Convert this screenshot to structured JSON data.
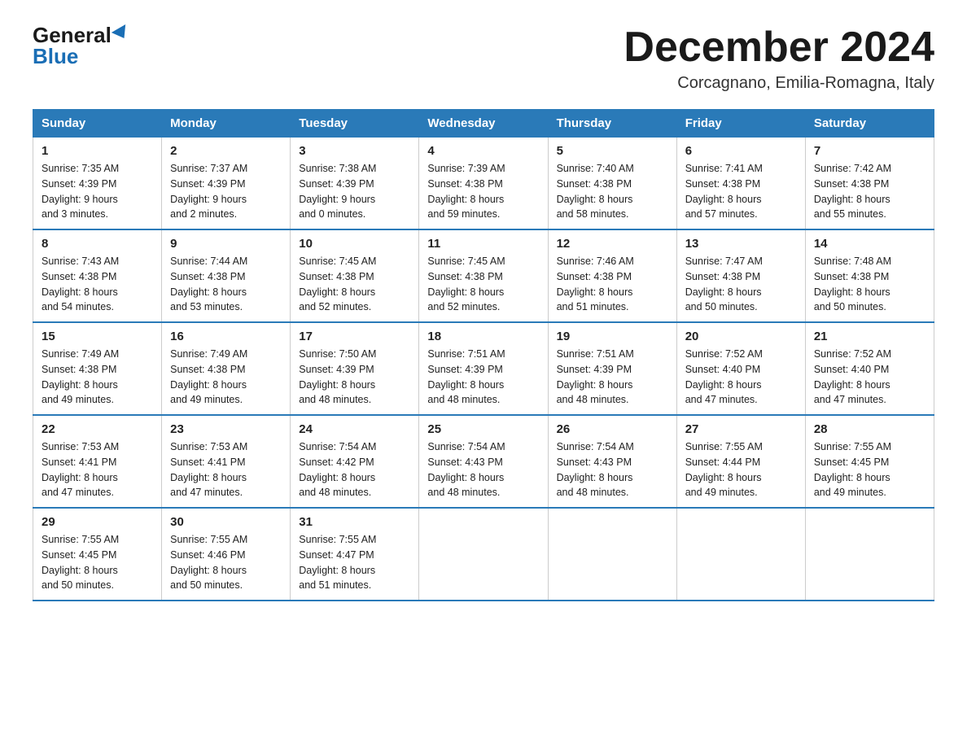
{
  "header": {
    "logo_general": "General",
    "logo_blue": "Blue",
    "month_title": "December 2024",
    "location": "Corcagnano, Emilia-Romagna, Italy"
  },
  "days_of_week": [
    "Sunday",
    "Monday",
    "Tuesday",
    "Wednesday",
    "Thursday",
    "Friday",
    "Saturday"
  ],
  "weeks": [
    [
      {
        "day": "1",
        "sunrise": "7:35 AM",
        "sunset": "4:39 PM",
        "daylight": "9 hours and 3 minutes."
      },
      {
        "day": "2",
        "sunrise": "7:37 AM",
        "sunset": "4:39 PM",
        "daylight": "9 hours and 2 minutes."
      },
      {
        "day": "3",
        "sunrise": "7:38 AM",
        "sunset": "4:39 PM",
        "daylight": "9 hours and 0 minutes."
      },
      {
        "day": "4",
        "sunrise": "7:39 AM",
        "sunset": "4:38 PM",
        "daylight": "8 hours and 59 minutes."
      },
      {
        "day": "5",
        "sunrise": "7:40 AM",
        "sunset": "4:38 PM",
        "daylight": "8 hours and 58 minutes."
      },
      {
        "day": "6",
        "sunrise": "7:41 AM",
        "sunset": "4:38 PM",
        "daylight": "8 hours and 57 minutes."
      },
      {
        "day": "7",
        "sunrise": "7:42 AM",
        "sunset": "4:38 PM",
        "daylight": "8 hours and 55 minutes."
      }
    ],
    [
      {
        "day": "8",
        "sunrise": "7:43 AM",
        "sunset": "4:38 PM",
        "daylight": "8 hours and 54 minutes."
      },
      {
        "day": "9",
        "sunrise": "7:44 AM",
        "sunset": "4:38 PM",
        "daylight": "8 hours and 53 minutes."
      },
      {
        "day": "10",
        "sunrise": "7:45 AM",
        "sunset": "4:38 PM",
        "daylight": "8 hours and 52 minutes."
      },
      {
        "day": "11",
        "sunrise": "7:45 AM",
        "sunset": "4:38 PM",
        "daylight": "8 hours and 52 minutes."
      },
      {
        "day": "12",
        "sunrise": "7:46 AM",
        "sunset": "4:38 PM",
        "daylight": "8 hours and 51 minutes."
      },
      {
        "day": "13",
        "sunrise": "7:47 AM",
        "sunset": "4:38 PM",
        "daylight": "8 hours and 50 minutes."
      },
      {
        "day": "14",
        "sunrise": "7:48 AM",
        "sunset": "4:38 PM",
        "daylight": "8 hours and 50 minutes."
      }
    ],
    [
      {
        "day": "15",
        "sunrise": "7:49 AM",
        "sunset": "4:38 PM",
        "daylight": "8 hours and 49 minutes."
      },
      {
        "day": "16",
        "sunrise": "7:49 AM",
        "sunset": "4:38 PM",
        "daylight": "8 hours and 49 minutes."
      },
      {
        "day": "17",
        "sunrise": "7:50 AM",
        "sunset": "4:39 PM",
        "daylight": "8 hours and 48 minutes."
      },
      {
        "day": "18",
        "sunrise": "7:51 AM",
        "sunset": "4:39 PM",
        "daylight": "8 hours and 48 minutes."
      },
      {
        "day": "19",
        "sunrise": "7:51 AM",
        "sunset": "4:39 PM",
        "daylight": "8 hours and 48 minutes."
      },
      {
        "day": "20",
        "sunrise": "7:52 AM",
        "sunset": "4:40 PM",
        "daylight": "8 hours and 47 minutes."
      },
      {
        "day": "21",
        "sunrise": "7:52 AM",
        "sunset": "4:40 PM",
        "daylight": "8 hours and 47 minutes."
      }
    ],
    [
      {
        "day": "22",
        "sunrise": "7:53 AM",
        "sunset": "4:41 PM",
        "daylight": "8 hours and 47 minutes."
      },
      {
        "day": "23",
        "sunrise": "7:53 AM",
        "sunset": "4:41 PM",
        "daylight": "8 hours and 47 minutes."
      },
      {
        "day": "24",
        "sunrise": "7:54 AM",
        "sunset": "4:42 PM",
        "daylight": "8 hours and 48 minutes."
      },
      {
        "day": "25",
        "sunrise": "7:54 AM",
        "sunset": "4:43 PM",
        "daylight": "8 hours and 48 minutes."
      },
      {
        "day": "26",
        "sunrise": "7:54 AM",
        "sunset": "4:43 PM",
        "daylight": "8 hours and 48 minutes."
      },
      {
        "day": "27",
        "sunrise": "7:55 AM",
        "sunset": "4:44 PM",
        "daylight": "8 hours and 49 minutes."
      },
      {
        "day": "28",
        "sunrise": "7:55 AM",
        "sunset": "4:45 PM",
        "daylight": "8 hours and 49 minutes."
      }
    ],
    [
      {
        "day": "29",
        "sunrise": "7:55 AM",
        "sunset": "4:45 PM",
        "daylight": "8 hours and 50 minutes."
      },
      {
        "day": "30",
        "sunrise": "7:55 AM",
        "sunset": "4:46 PM",
        "daylight": "8 hours and 50 minutes."
      },
      {
        "day": "31",
        "sunrise": "7:55 AM",
        "sunset": "4:47 PM",
        "daylight": "8 hours and 51 minutes."
      },
      null,
      null,
      null,
      null
    ]
  ],
  "labels": {
    "sunrise": "Sunrise:",
    "sunset": "Sunset:",
    "daylight": "Daylight:"
  }
}
